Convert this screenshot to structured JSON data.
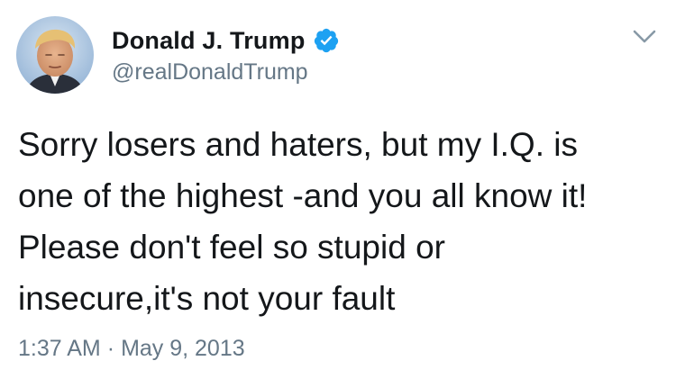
{
  "author": {
    "display_name": "Donald J. Trump",
    "handle": "@realDonaldTrump",
    "verified": true,
    "verified_icon": "verified-badge-icon",
    "avatar_icon": "profile-photo"
  },
  "tweet": {
    "lines": [
      "Sorry losers and haters, but my I.Q. is",
      "one of the highest -and you all know it!",
      "Please don't feel so stupid or",
      "insecure,it's not your fault"
    ],
    "time": "1:37 AM",
    "separator": "·",
    "date": "May 9, 2013"
  },
  "menu": {
    "icon": "chevron-down-icon"
  },
  "colors": {
    "text": "#14171a",
    "secondary": "#657786",
    "verified_blue": "#1da1f2",
    "caret": "#8899a6"
  }
}
